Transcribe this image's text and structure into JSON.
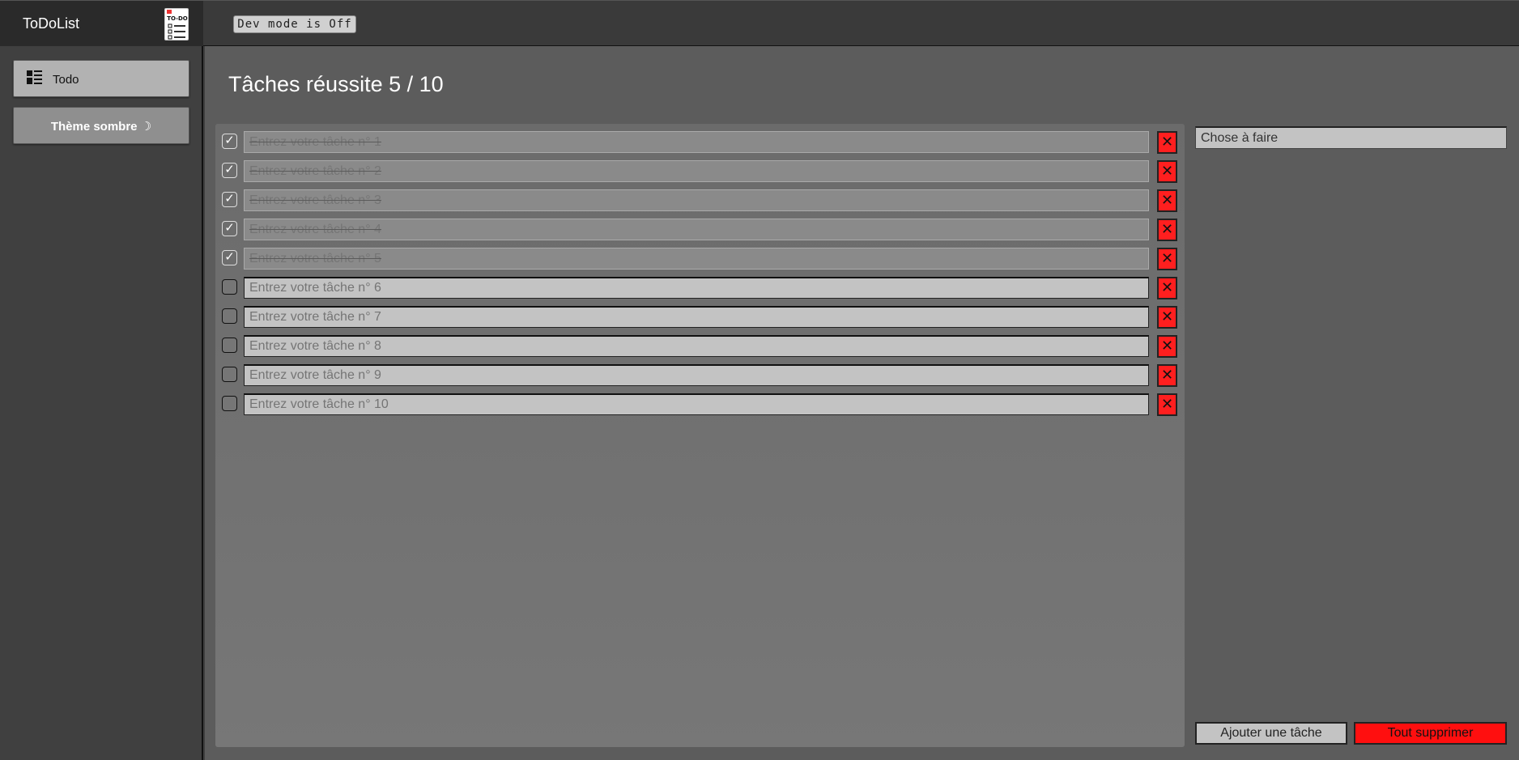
{
  "app": {
    "title": "ToDoList",
    "logo_icon": "todo-list-logo-icon"
  },
  "topbar": {
    "dev_mode_label": "Dev mode is Off"
  },
  "sidebar": {
    "items": [
      {
        "label": "Todo",
        "icon": "list-layout-icon"
      },
      {
        "label": "Thème sombre ☽"
      }
    ]
  },
  "main": {
    "heading": "Tâches réussite 5 / 10",
    "tasks": [
      {
        "placeholder": "Entrez votre tâche n° 1",
        "done": true
      },
      {
        "placeholder": "Entrez votre tâche n° 2",
        "done": true
      },
      {
        "placeholder": "Entrez votre tâche n° 3",
        "done": true
      },
      {
        "placeholder": "Entrez votre tâche n° 4",
        "done": true
      },
      {
        "placeholder": "Entrez votre tâche n° 5",
        "done": true
      },
      {
        "placeholder": "Entrez votre tâche n° 6",
        "done": false
      },
      {
        "placeholder": "Entrez votre tâche n° 7",
        "done": false
      },
      {
        "placeholder": "Entrez votre tâche n° 8",
        "done": false
      },
      {
        "placeholder": "Entrez votre tâche n° 9",
        "done": false
      },
      {
        "placeholder": "Entrez votre tâche n° 10",
        "done": false
      }
    ],
    "delete_symbol": "✕",
    "check_symbol": "✓",
    "new_task_placeholder": "Chose à faire",
    "add_label": "Ajouter une tâche",
    "clear_all_label": "Tout supprimer"
  },
  "colors": {
    "delete": "#ff1f1f",
    "clear_all": "#ff0f0f"
  }
}
